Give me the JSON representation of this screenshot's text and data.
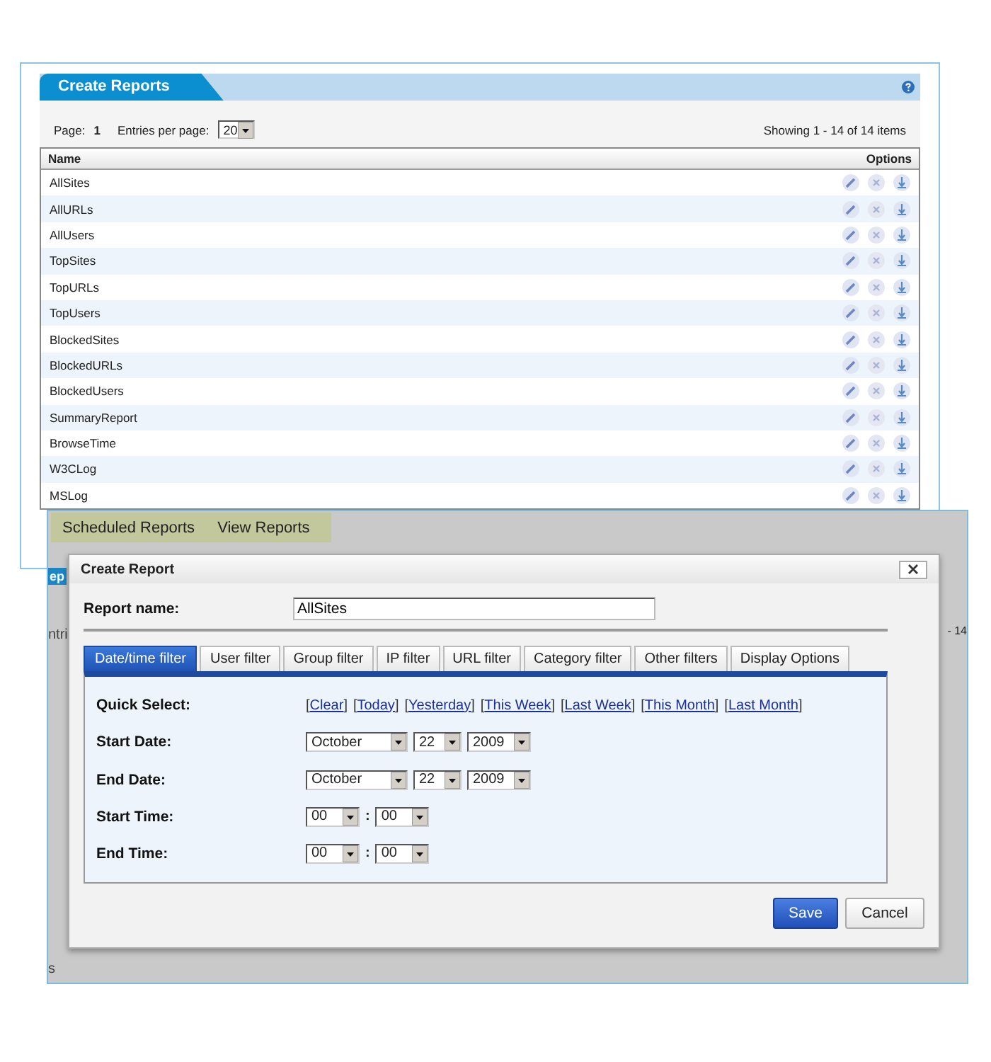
{
  "report_list": {
    "title": "Create Reports",
    "page_label": "Page:",
    "page": "1",
    "entries_label": "Entries per page:",
    "entries": "20",
    "showing": "Showing 1 - 14 of 14 items",
    "columns": [
      "Name",
      "Options"
    ],
    "rows": [
      {
        "name": "AllSites"
      },
      {
        "name": "AllURLs"
      },
      {
        "name": "AllUsers"
      },
      {
        "name": "TopSites"
      },
      {
        "name": "TopURLs"
      },
      {
        "name": "TopUsers"
      },
      {
        "name": "BlockedSites"
      },
      {
        "name": "BlockedURLs"
      },
      {
        "name": "BlockedUsers"
      },
      {
        "name": "SummaryReport"
      },
      {
        "name": "BrowseTime"
      },
      {
        "name": "W3CLog"
      },
      {
        "name": "MSLog"
      }
    ]
  },
  "background_window": {
    "tabs": [
      "Scheduled Reports",
      "View Reports"
    ],
    "fragments": [
      {
        "kind": "header",
        "text": "ep"
      },
      {
        "kind": "left",
        "text": "ntri"
      },
      {
        "kind": "right",
        "text": "- 14"
      },
      {
        "kind": "footer",
        "text": "s"
      }
    ]
  },
  "dialog": {
    "title": "Create Report",
    "name_label": "Report name:",
    "name_value": "AllSites",
    "tabs": [
      {
        "label": "Date/time filter",
        "selected": true
      },
      {
        "label": "User filter",
        "selected": false
      },
      {
        "label": "Group filter",
        "selected": false
      },
      {
        "label": "IP filter",
        "selected": false
      },
      {
        "label": "URL filter",
        "selected": false
      },
      {
        "label": "Category filter",
        "selected": false
      },
      {
        "label": "Other filters",
        "selected": false
      },
      {
        "label": "Display Options",
        "selected": false
      }
    ],
    "quick_label": "Quick Select:",
    "bracket_open": "[",
    "bracket_close": "]",
    "quick_links": [
      "Clear",
      "Today",
      "Yesterday",
      "This Week",
      "Last Week",
      "This Month",
      "Last Month"
    ],
    "fields": [
      {
        "label": "Start Date:",
        "kind": "date",
        "values": [
          "October",
          "22",
          "2009"
        ]
      },
      {
        "label": "End Date:",
        "kind": "date",
        "values": [
          "October",
          "22",
          "2009"
        ]
      },
      {
        "label": "Start Time:",
        "kind": "time",
        "values": [
          "00",
          "00"
        ],
        "separator": ":"
      },
      {
        "label": "End Time:",
        "kind": "time",
        "values": [
          "00",
          "00"
        ],
        "separator": ":"
      }
    ],
    "buttons": [
      {
        "label": "Save",
        "kind": "primary"
      },
      {
        "label": "Cancel",
        "kind": "secondary"
      }
    ]
  }
}
